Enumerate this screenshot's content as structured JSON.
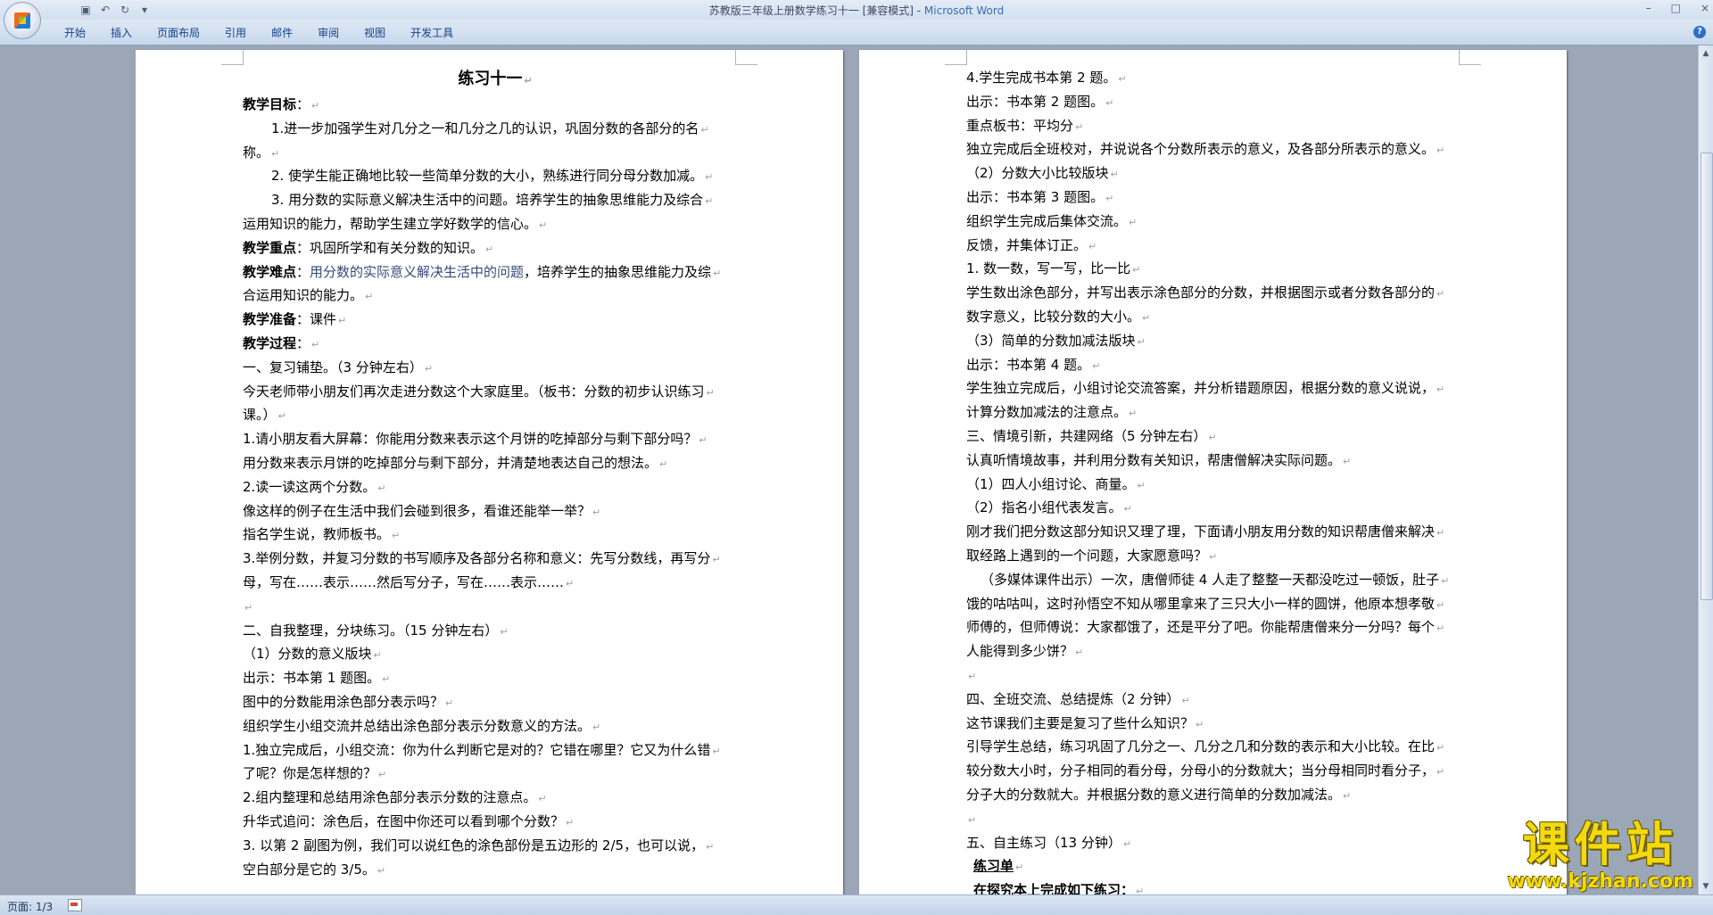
{
  "window": {
    "title": "苏教版三年级上册数学练习十一 [兼容模式] - ",
    "app_name": "Microsoft Word",
    "minimize_glyph": "–",
    "maximize_glyph": "□",
    "close_glyph": "×"
  },
  "quick_access": {
    "save_icon": "save-icon",
    "undo_icon": "undo-icon",
    "redo_icon": "redo-icon",
    "customize_icon": "chevron-down-icon",
    "save_glyph": "▣",
    "undo_glyph": "↶",
    "redo_glyph": "↻",
    "customize_glyph": "▾"
  },
  "ribbon": {
    "tabs": [
      "开始",
      "插入",
      "页面布局",
      "引用",
      "邮件",
      "审阅",
      "视图",
      "开发工具"
    ],
    "help_glyph": "?"
  },
  "left_page": {
    "lines": [
      {
        "text": "练习十一",
        "style": "title"
      },
      {
        "label": "教学目标",
        "text": "："
      },
      {
        "text": "1.进一步加强学生对几分之一和几分之几的认识，巩固分数的各部分的名",
        "style": "indent"
      },
      {
        "text": "称。"
      },
      {
        "text": "2.  使学生能正确地比较一些简单分数的大小，熟练进行同分母分数加减。",
        "style": "indent"
      },
      {
        "text": "3.  用分数的实际意义解决生活中的问题。培养学生的抽象思维能力及综合",
        "style": "indent"
      },
      {
        "text": "运用知识的能力，帮助学生建立学好数学的信心。"
      },
      {
        "label": "教学重点",
        "text": "：巩固所学和有关分数的知识。"
      },
      {
        "label": "教学难点",
        "text": "：",
        "highlight": "用分数的实际意义解决生活中的问题",
        "tail": "，培养学生的抽象思维能力及综"
      },
      {
        "text": "合运用知识的能力。"
      },
      {
        "label": "教学准备",
        "text": "：课件"
      },
      {
        "label": "教学过程",
        "text": "："
      },
      {
        "text": "一、复习铺垫。（3 分钟左右）"
      },
      {
        "text": "今天老师带小朋友们再次走进分数这个大家庭里。（板书：分数的初步认识练习"
      },
      {
        "text": "课。）"
      },
      {
        "text": "1.请小朋友看大屏幕：你能用分数来表示这个月饼的吃掉部分与剩下部分吗？"
      },
      {
        "text": "用分数来表示月饼的吃掉部分与剩下部分，并清楚地表达自己的想法。"
      },
      {
        "text": "2.读一读这两个分数。"
      },
      {
        "text": "像这样的例子在生活中我们会碰到很多，看谁还能举一举？"
      },
      {
        "text": "指名学生说，教师板书。"
      },
      {
        "text": "3.举例分数，并复习分数的书写顺序及各部分名称和意义：先写分数线，再写分"
      },
      {
        "text": "母，写在……表示……然后写分子，写在……表示……"
      },
      {
        "text": ""
      },
      {
        "text": "二、自我整理，分块练习。（15 分钟左右）"
      },
      {
        "text": "（1）分数的意义版块"
      },
      {
        "text": "出示：书本第 1 题图。"
      },
      {
        "text": "图中的分数能用涂色部分表示吗？"
      },
      {
        "text": "组织学生小组交流并总结出涂色部分表示分数意义的方法。"
      },
      {
        "text": "1.独立完成后，小组交流：你为什么判断它是对的？它错在哪里？它又为什么错"
      },
      {
        "text": "了呢？你是怎样想的？"
      },
      {
        "text": "2.组内整理和总结用涂色部分表示分数的注意点。"
      },
      {
        "text": "升华式追问：涂色后，在图中你还可以看到哪个分数？"
      },
      {
        "text": "3.  以第 2 副图为例，我们可以说红色的涂色部份是五边形的 2/5，也可以说，"
      },
      {
        "text": "空白部分是它的 3/5。"
      }
    ]
  },
  "right_page": {
    "lines": [
      {
        "text": "4.学生完成书本第 2 题。"
      },
      {
        "text": "出示：书本第 2 题图。"
      },
      {
        "text": "重点板书：平均分"
      },
      {
        "text": "独立完成后全班校对，并说说各个分数所表示的意义，及各部分所表示的意义。"
      },
      {
        "text": "（2）分数大小比较版块"
      },
      {
        "text": "出示：书本第 3 题图。"
      },
      {
        "text": "组织学生完成后集体交流。"
      },
      {
        "text": "反馈，并集体订正。"
      },
      {
        "text": "1.  数一数，写一写，比一比"
      },
      {
        "text": "学生数出涂色部分，并写出表示涂色部分的分数，并根据图示或者分数各部分的"
      },
      {
        "text": "数字意义，比较分数的大小。"
      },
      {
        "text": "（3）简单的分数加减法版块"
      },
      {
        "text": "出示：书本第 4 题。"
      },
      {
        "text": "学生独立完成后，小组讨论交流答案，并分析错题原因，根据分数的意义说说，"
      },
      {
        "text": "计算分数加减法的注意点。"
      },
      {
        "text": "三、情境引新，共建网络（5 分钟左右）"
      },
      {
        "text": "认真听情境故事，并利用分数有关知识，帮唐僧解决实际问题。"
      },
      {
        "text": "（1）四人小组讨论、商量。"
      },
      {
        "text": "（2）指名小组代表发言。"
      },
      {
        "text": "刚才我们把分数这部分知识又理了理，下面请小朋友用分数的知识帮唐僧来解决"
      },
      {
        "text": "取经路上遇到的一个问题，大家愿意吗？"
      },
      {
        "text": "（多媒体课件出示）一次，唐僧师徒 4 人走了整整一天都没吃过一顿饭，肚子",
        "style": "indent-small"
      },
      {
        "text": "饿的咕咕叫，这时孙悟空不知从哪里拿来了三只大小一样的圆饼，他原本想孝敬"
      },
      {
        "text": "师傅的，但师傅说：大家都饿了，还是平分了吧。你能帮唐僧来分一分吗？每个"
      },
      {
        "text": "人能得到多少饼？"
      },
      {
        "text": ""
      },
      {
        "text": "四、全班交流、总结提炼（2 分钟）"
      },
      {
        "text": "这节课我们主要是复习了些什么知识？"
      },
      {
        "text": "引导学生总结，练习巩固了几分之一、几分之几和分数的表示和大小比较。在比"
      },
      {
        "text": "较分数大小时，分子相同的看分母，分母小的分数就大；当分母相同时看分子，"
      },
      {
        "text": "分子大的分数就大。并根据分数的意义进行简单的分数加减法。"
      },
      {
        "text": ""
      },
      {
        "text": "五、自主练习（13 分钟）"
      },
      {
        "text": "练习单",
        "style": "bold-u"
      },
      {
        "text": "在探究本上完成如下练习：",
        "style": "bold-u-indent"
      }
    ]
  },
  "para_mark": "↵",
  "scrollbar": {
    "up_glyph": "▲",
    "down_glyph": "▼"
  },
  "status": {
    "page_indicator": "页面: 1/3"
  },
  "watermark": {
    "title": "课件站",
    "url": "www.kjzhan.com"
  }
}
